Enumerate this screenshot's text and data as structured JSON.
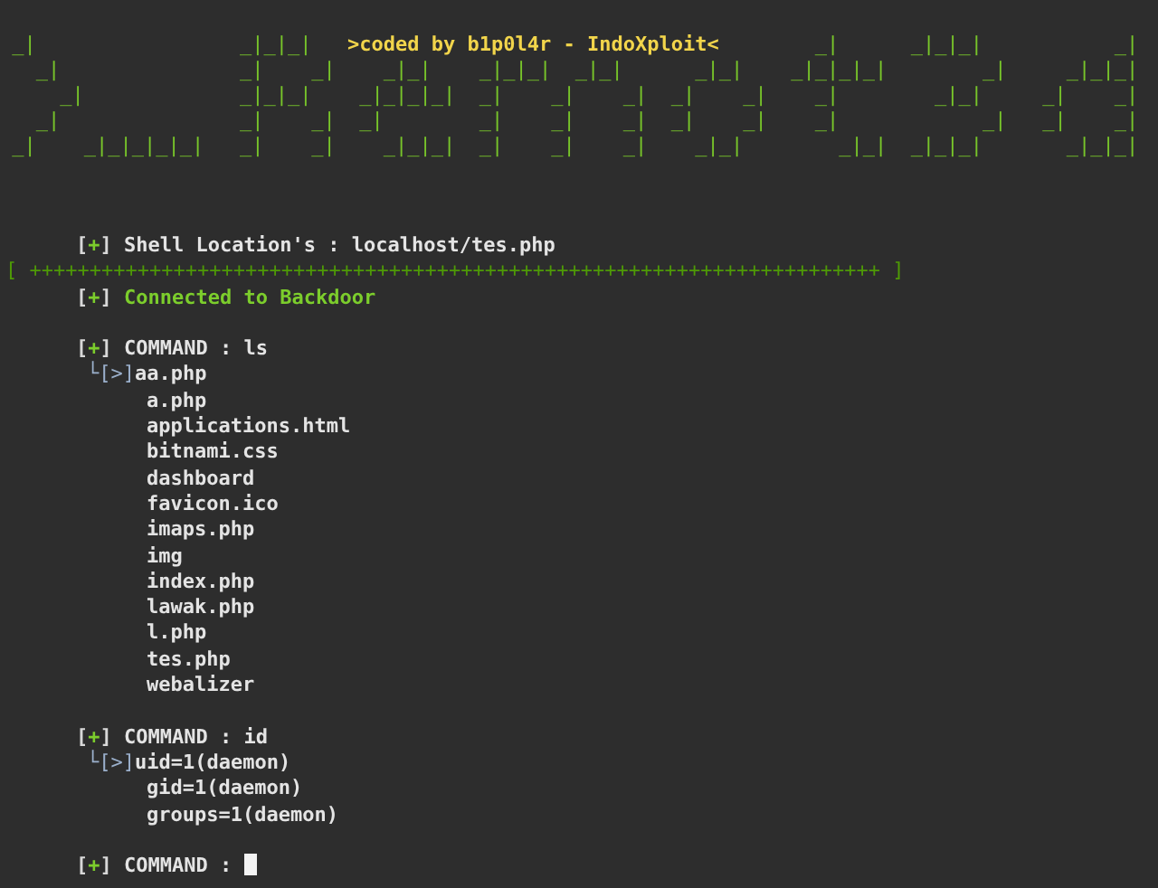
{
  "banner": {
    "first_row_left": " _|                 _|_|_|",
    "tagline": ">coded by b1p0l4r - IndoXploit<",
    "first_row_right": "        _|      _|_|_|           _|",
    "rows": [
      "   _|               _|    _|    _|_|    _|_|_|  _|_|      _|_|    _|_|_|_|        _|     _|_|_|",
      "     _|             _|_|_|    _|_|_|_|  _|    _|    _|  _|    _|    _|        _|_|     _|    _|",
      "   _|               _|    _|  _|        _|    _|    _|  _|    _|    _|            _|   _|    _|",
      " _|    _|_|_|_|_|   _|    _|    _|_|_|  _|    _|    _|    _|_|        _|_|  _|_|_|       _|_|_|"
    ]
  },
  "shell_location": {
    "marker": "[+]",
    "text": "Shell Location's : localhost/tes.php"
  },
  "separator": "[ +++++++++++++++++++++++++++++++++++++++++++++++++++++++++++++++++++++++ ]",
  "status": {
    "marker": "[+]",
    "text": "Connected to Backdoor"
  },
  "commands": [
    {
      "marker": "[+]",
      "prompt": "COMMAND : ls",
      "output_marker": "└[>]",
      "output": [
        "aa.php",
        "a.php",
        "applications.html",
        "bitnami.css",
        "dashboard",
        "favicon.ico",
        "imaps.php",
        "img",
        "index.php",
        "lawak.php",
        "l.php",
        "tes.php",
        "webalizer"
      ]
    },
    {
      "marker": "[+]",
      "prompt": "COMMAND : id",
      "output_marker": "└[>]",
      "output": [
        "uid=1(daemon)",
        "gid=1(daemon)",
        "groups=1(daemon)"
      ]
    }
  ],
  "input": {
    "marker": "[+]",
    "prompt": "COMMAND :"
  }
}
